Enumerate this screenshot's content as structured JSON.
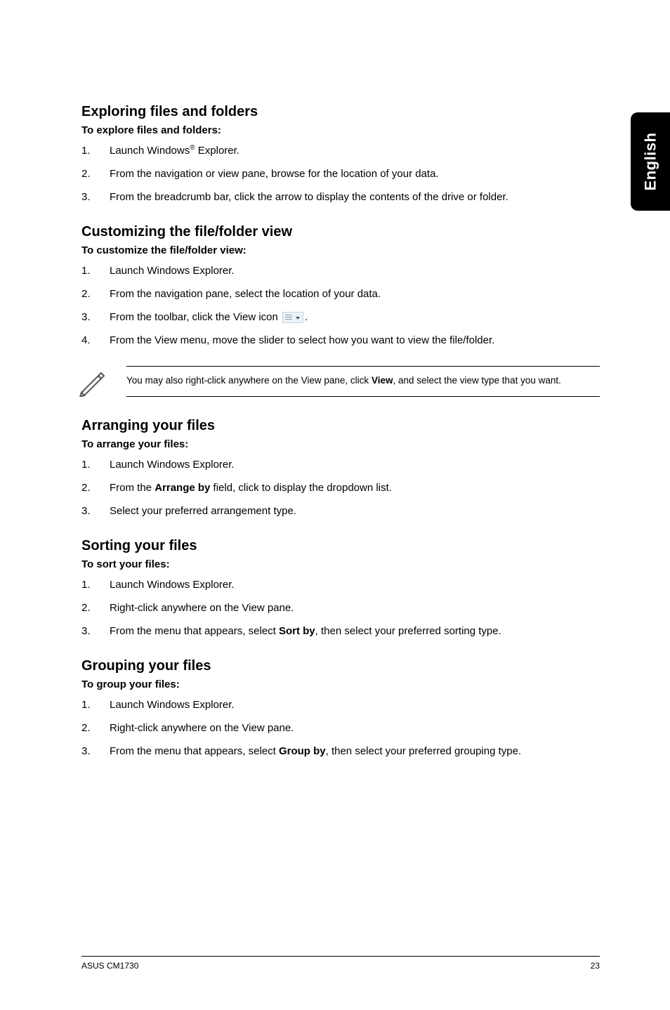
{
  "side_tab": "English",
  "sections": {
    "explore": {
      "heading": "Exploring files and folders",
      "subhead": "To explore files and folders:",
      "steps": [
        {
          "n": "1.",
          "pre": "Launch Windows",
          "sup": "®",
          "post": " Explorer."
        },
        {
          "n": "2.",
          "text": "From the navigation or view pane, browse for the location of your data."
        },
        {
          "n": "3.",
          "text": "From the breadcrumb bar, click the arrow to display the contents of the drive or folder."
        }
      ]
    },
    "customize": {
      "heading": "Customizing the file/folder view",
      "subhead": "To customize the file/folder view:",
      "steps": [
        {
          "n": "1.",
          "text": "Launch Windows Explorer."
        },
        {
          "n": "2.",
          "text": "From the navigation pane, select the location of your data."
        },
        {
          "n": "3.",
          "pre": "From the toolbar, click the View icon ",
          "icon": true,
          "post": "."
        },
        {
          "n": "4.",
          "text": "From the View menu, move the slider to select how you want to view the file/folder."
        }
      ],
      "note_pre": "You may also right-click anywhere on the View pane, click ",
      "note_bold": "View",
      "note_post": ", and select the view type that you want."
    },
    "arrange": {
      "heading": "Arranging your files",
      "subhead": "To arrange your files:",
      "steps": [
        {
          "n": "1.",
          "text": "Launch Windows Explorer."
        },
        {
          "n": "2.",
          "pre": "From the ",
          "bold": "Arrange by",
          "post": " field, click to display the dropdown list."
        },
        {
          "n": "3.",
          "text": "Select your preferred arrangement type."
        }
      ]
    },
    "sort": {
      "heading": "Sorting your files",
      "subhead": "To sort your files:",
      "steps": [
        {
          "n": "1.",
          "text": "Launch Windows Explorer."
        },
        {
          "n": "2.",
          "text": "Right-click anywhere on the View pane."
        },
        {
          "n": "3.",
          "pre": "From the menu that appears, select ",
          "bold": "Sort by",
          "post": ", then select your preferred sorting type."
        }
      ]
    },
    "group": {
      "heading": "Grouping your files",
      "subhead": "To group your files:",
      "steps": [
        {
          "n": "1.",
          "text": "Launch Windows Explorer."
        },
        {
          "n": "2.",
          "text": "Right-click anywhere on the View pane."
        },
        {
          "n": "3.",
          "pre": "From the menu that appears, select ",
          "bold": "Group by",
          "post": ", then select your preferred grouping type."
        }
      ]
    }
  },
  "footer": {
    "left": "ASUS CM1730",
    "right": "23"
  }
}
